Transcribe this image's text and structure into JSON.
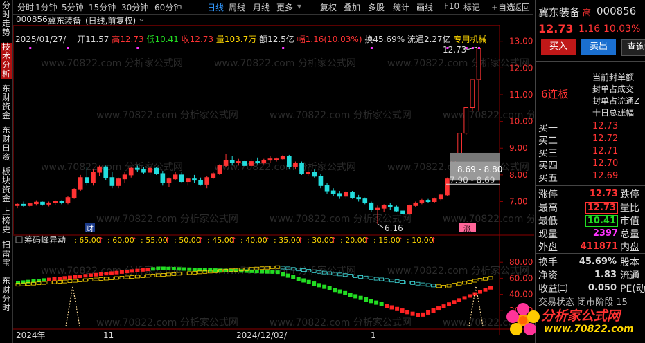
{
  "left_tabs": [
    "分时走势",
    "技术分析",
    "东财资金",
    "东财日资",
    "板块资金",
    "上榜史",
    "扫雷宝",
    "东财分时"
  ],
  "toolbar": {
    "items": [
      "分时",
      "1分钟",
      "5分钟",
      "15分钟",
      "30分钟",
      "60分钟",
      "日线",
      "周线",
      "月线",
      "更多"
    ],
    "active": "日线",
    "right_items": [
      "复权",
      "叠加",
      "多股",
      "统计",
      "画线",
      "F10",
      "标记",
      "+自选",
      "返回"
    ]
  },
  "stock_header": {
    "code": "000856",
    "name": "冀东装备",
    "period": "(日线,前复权)"
  },
  "info": {
    "date": "2025/01/27/一",
    "open_label": "开",
    "open": "11.57",
    "high_label": "高",
    "high": "12.73",
    "low_label": "低",
    "low": "10.41",
    "close_label": "收",
    "close": "12.73",
    "vol_label": "量",
    "vol": "103.7万",
    "amt_label": "额",
    "amt": "12.5亿",
    "chg_label": "幅",
    "chg": "1.16(10.03%)",
    "turn_label": "换",
    "turn": "45.69%",
    "float_label": "流通",
    "float": "2.27亿",
    "sector": "专用机械"
  },
  "price_axis": [
    "13.00",
    "12.00",
    "11.00",
    "10.00",
    "9.00",
    "8.00",
    "7.00"
  ],
  "annotations": {
    "high_mark": "12.73",
    "low_mark": "6.16",
    "box_top": "8.69 - 8.80",
    "box_mid": "7.90 - 8.69",
    "cai_badge": "财",
    "limit_badge": "涨"
  },
  "indicator": {
    "name": "筹码峰异动",
    "levels": [
      ": 65.00",
      ": 60.00",
      ": 55.00",
      ": 50.00",
      ": 45.00",
      ": 40.00",
      ": 35.00",
      ": 30.00",
      ": 20.00",
      ": 15.00",
      ": 10.00"
    ],
    "axis": [
      "80.00",
      "60.00",
      "40.00",
      "20.00"
    ]
  },
  "x_axis": [
    "2024年",
    "11",
    "2024/12/02/一",
    "1"
  ],
  "watermark": "www.70822.com 分析家公式网",
  "brand": {
    "title": "分析家公式网",
    "url": "www.70822.com"
  },
  "right_panel": {
    "name": "冀东装备",
    "high_tag": "高",
    "code": "000856",
    "price": "12.73",
    "change": "1.16",
    "pct": "10.03%",
    "buy_label": "买入",
    "sell_label": "卖出",
    "query_label": "查询",
    "streak": "6连板",
    "limit_info": [
      "当前封单额",
      "封单占成交",
      "封单占流通Z",
      "十日总涨幅"
    ],
    "bids": [
      {
        "label": "买一",
        "price": "12.73"
      },
      {
        "label": "买二",
        "price": "12.72"
      },
      {
        "label": "买三",
        "price": "12.71"
      },
      {
        "label": "买四",
        "price": "12.70"
      },
      {
        "label": "买五",
        "price": "12.69"
      }
    ],
    "stats": [
      {
        "label": "涨停",
        "value": "12.73",
        "label2": "跌停"
      },
      {
        "label": "最高",
        "value": "12.73",
        "label2": "量比"
      },
      {
        "label": "最低",
        "value": "10.41",
        "label2": "市值"
      },
      {
        "label": "现量",
        "value": "2397",
        "label2": "总量"
      },
      {
        "label": "外盘",
        "value": "411871",
        "label2": "内盘"
      }
    ],
    "stats2": [
      {
        "label": "换手",
        "value": "45.69%",
        "label2": "股本"
      },
      {
        "label": "净资",
        "value": "1.83",
        "label2": "流通"
      },
      {
        "label": "收益㈢",
        "value": "0.050",
        "label2": "PE(动"
      }
    ],
    "bottom": "交易状态 闭市阶段 15"
  },
  "colors": {
    "up": "#ff3333",
    "down": "#22dddd",
    "accent": "#3399ff"
  },
  "chart_data": {
    "type": "candlestick",
    "ylim": [
      5.9,
      13.2
    ],
    "candles": [
      [
        6.85,
        6.95,
        6.75,
        6.9
      ],
      [
        6.9,
        7.0,
        6.8,
        6.85
      ],
      [
        6.85,
        6.95,
        6.78,
        6.92
      ],
      [
        6.92,
        7.05,
        6.85,
        6.98
      ],
      [
        6.98,
        7.0,
        6.85,
        6.9
      ],
      [
        6.9,
        7.0,
        6.82,
        6.95
      ],
      [
        6.95,
        7.05,
        6.88,
        7.0
      ],
      [
        7.0,
        7.05,
        6.9,
        6.95
      ],
      [
        6.95,
        7.2,
        6.9,
        7.15
      ],
      [
        7.15,
        7.5,
        7.1,
        7.45
      ],
      [
        7.45,
        8.0,
        7.4,
        7.9
      ],
      [
        7.9,
        8.3,
        7.6,
        7.7
      ],
      [
        7.7,
        8.2,
        7.6,
        8.1
      ],
      [
        8.1,
        8.35,
        7.95,
        8.3
      ],
      [
        8.3,
        8.35,
        7.8,
        7.9
      ],
      [
        7.9,
        8.1,
        7.5,
        7.6
      ],
      [
        7.6,
        7.9,
        7.5,
        7.85
      ],
      [
        7.85,
        8.1,
        7.7,
        8.0
      ],
      [
        8.0,
        8.3,
        7.9,
        8.25
      ],
      [
        8.25,
        8.35,
        8.1,
        8.2
      ],
      [
        8.2,
        8.3,
        8.05,
        8.1
      ],
      [
        8.1,
        8.3,
        8.0,
        8.25
      ],
      [
        8.25,
        8.3,
        8.0,
        8.05
      ],
      [
        8.05,
        8.15,
        7.6,
        7.7
      ],
      [
        7.7,
        7.9,
        7.55,
        7.85
      ],
      [
        7.85,
        8.1,
        7.8,
        8.0
      ],
      [
        8.0,
        8.1,
        7.7,
        7.75
      ],
      [
        7.75,
        7.9,
        7.6,
        7.85
      ],
      [
        7.85,
        8.0,
        7.7,
        7.8
      ],
      [
        7.8,
        7.9,
        7.6,
        7.65
      ],
      [
        7.65,
        7.95,
        7.5,
        7.9
      ],
      [
        7.9,
        8.1,
        7.85,
        8.05
      ],
      [
        8.05,
        8.4,
        8.0,
        8.35
      ],
      [
        8.35,
        8.8,
        8.3,
        8.55
      ],
      [
        8.55,
        8.7,
        8.35,
        8.45
      ],
      [
        8.45,
        8.6,
        8.35,
        8.5
      ],
      [
        8.5,
        8.55,
        8.3,
        8.35
      ],
      [
        8.35,
        8.6,
        8.3,
        8.5
      ],
      [
        8.5,
        8.65,
        8.4,
        8.45
      ],
      [
        8.45,
        8.6,
        8.4,
        8.55
      ],
      [
        8.55,
        8.7,
        8.45,
        8.6
      ],
      [
        8.6,
        8.65,
        8.5,
        8.6
      ],
      [
        8.6,
        8.75,
        8.55,
        8.7
      ],
      [
        8.7,
        8.75,
        8.2,
        8.3
      ],
      [
        8.3,
        8.5,
        8.2,
        8.45
      ],
      [
        8.45,
        8.5,
        8.0,
        8.05
      ],
      [
        8.05,
        8.2,
        7.95,
        8.1
      ],
      [
        8.1,
        8.2,
        7.9,
        7.95
      ],
      [
        7.95,
        8.05,
        7.5,
        7.6
      ],
      [
        7.6,
        7.7,
        7.3,
        7.4
      ],
      [
        7.4,
        7.5,
        7.2,
        7.3
      ],
      [
        7.3,
        7.4,
        7.1,
        7.2
      ],
      [
        7.2,
        7.4,
        7.1,
        7.35
      ],
      [
        7.35,
        7.4,
        7.1,
        7.15
      ],
      [
        7.15,
        7.25,
        7.0,
        7.1
      ],
      [
        7.1,
        7.15,
        6.9,
        6.95
      ],
      [
        6.95,
        7.0,
        6.6,
        6.7
      ],
      [
        6.7,
        6.85,
        6.16,
        6.75
      ],
      [
        6.75,
        6.9,
        6.6,
        6.85
      ],
      [
        6.85,
        6.95,
        6.7,
        6.8
      ],
      [
        6.8,
        6.85,
        6.6,
        6.65
      ],
      [
        6.65,
        6.75,
        6.5,
        6.55
      ],
      [
        6.55,
        6.9,
        6.5,
        6.85
      ],
      [
        6.85,
        7.0,
        6.8,
        6.95
      ],
      [
        6.95,
        7.1,
        6.9,
        7.05
      ],
      [
        7.05,
        7.1,
        6.95,
        7.0
      ],
      [
        7.0,
        7.15,
        6.95,
        7.1
      ],
      [
        7.1,
        7.3,
        7.05,
        7.25
      ],
      [
        7.25,
        7.9,
        7.2,
        7.85
      ],
      [
        7.85,
        8.69,
        7.85,
        8.69
      ],
      [
        8.8,
        9.56,
        8.8,
        9.56
      ],
      [
        9.56,
        10.52,
        9.5,
        10.52
      ],
      [
        10.52,
        11.57,
        10.4,
        11.57
      ],
      [
        11.57,
        12.73,
        10.41,
        12.73
      ]
    ]
  }
}
